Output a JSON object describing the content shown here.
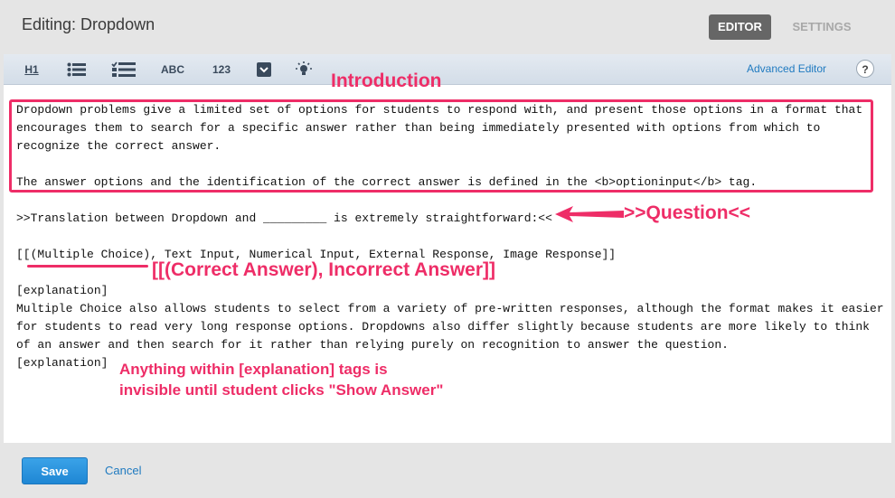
{
  "header": {
    "title": "Editing: Dropdown",
    "tabs": [
      {
        "label": "EDITOR",
        "active": true
      },
      {
        "label": "SETTINGS",
        "active": false
      }
    ]
  },
  "toolbar": {
    "buttons": [
      {
        "label": "H1",
        "icon": "heading-icon"
      },
      {
        "label": "",
        "icon": "bulleted-list-icon"
      },
      {
        "label": "",
        "icon": "checklist-icon"
      },
      {
        "label": "ABC",
        "icon": "text-input-icon"
      },
      {
        "label": "123",
        "icon": "numerical-input-icon"
      },
      {
        "label": "",
        "icon": "dropdown-icon"
      },
      {
        "label": "",
        "icon": "lightbulb-icon"
      }
    ],
    "advanced_editor": "Advanced Editor",
    "help": "?"
  },
  "content": {
    "lines": [
      "Dropdown problems give a limited set of options for students to respond with, and present those options in a format that",
      "encourages them to search for a specific answer rather than being immediately presented with options from which to",
      "recognize the correct answer.",
      "",
      "The answer options and the identification of the correct answer is defined in the <b>optioninput</b> tag.",
      "",
      ">>Translation between Dropdown and _________ is extremely straightforward:<<",
      "",
      "[[(Multiple Choice), Text Input, Numerical Input, External Response, Image Response]]",
      "",
      "[explanation]",
      "Multiple Choice also allows students to select from a variety of pre-written responses, although the format makes it easier",
      "for students to read very long response options. Dropdowns also differ slightly because students are more likely to think",
      "of an answer and then search for it rather than relying purely on recognition to answer the question.",
      "[explanation]"
    ]
  },
  "annotations": {
    "introduction": "Introduction",
    "question": ">>Question<<",
    "answers": "[[(Correct Answer), Incorrect Answer]]",
    "explanation_line1": "Anything within [explanation] tags is",
    "explanation_line2": "invisible until student clicks \"Show Answer\"",
    "color": "#ee2d67"
  },
  "footer": {
    "save": "Save",
    "cancel": "Cancel"
  }
}
